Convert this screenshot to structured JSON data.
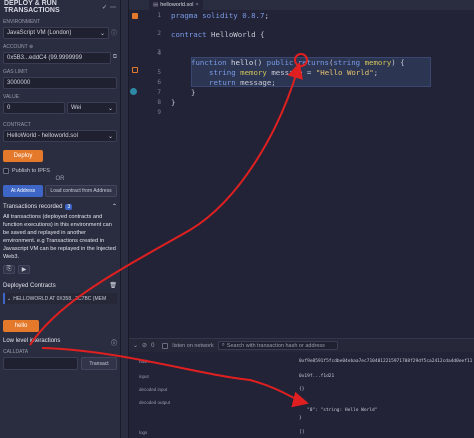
{
  "left_panel": {
    "title": "DEPLOY & RUN TRANSACTIONS",
    "environment": {
      "label": "ENVIRONMENT",
      "value": "JavaScript VM (London)"
    },
    "account": {
      "label": "ACCOUNT",
      "value": "0x5B3...eddC4 (99.9999999"
    },
    "gas_limit": {
      "label": "GAS LIMIT",
      "value": "3000000"
    },
    "value": {
      "label": "VALUE",
      "amount": "0",
      "unit": "Wei"
    },
    "contract": {
      "label": "CONTRACT",
      "value": "HelloWorld - helloworld.sol"
    },
    "deploy_label": "Deploy",
    "publish_label": "Publish to IPFS",
    "or_label": "OR",
    "at_address_label": "At Address",
    "load_contract_label": "Load contract from Address",
    "transactions": {
      "label": "Transactions recorded",
      "count": "3"
    },
    "info_text": "All transactions (deployed contracts and function executions) in this environment can be saved and replayed in another environment. e.g Transactions created in Javascript VM can be replayed in the Injected Web3.",
    "deployed_label": "Deployed Contracts",
    "instance_label": "HELLOWORLD AT 0X358...2C7BC (MEM",
    "hello_label": "hello",
    "low_level_label": "Low level interactions",
    "calldata_label": "CALLDATA",
    "transact_label": "Transact"
  },
  "editor": {
    "tab_label": "helloworld.sol",
    "line_numbers": [
      "1",
      "2",
      "3",
      "4",
      "5",
      "6",
      "7",
      "8",
      "9"
    ],
    "lines": {
      "l1_a": "pragma solidity ",
      "l1_b": "0.8.7",
      "l1_c": ";",
      "l3_a": "contract ",
      "l3_b": "HelloWorld {",
      "l5_a": "function ",
      "l5_b": "hello() ",
      "l5_c": "public ",
      "l5_d": "returns",
      "l5_e": "(",
      "l5_f": "string ",
      "l5_g": "memory",
      "l5_h": ") {",
      "l6_a": "string ",
      "l6_b": "memory ",
      "l6_c": "message = ",
      "l6_d": "\"Hello World\"",
      "l6_e": ";",
      "l7_a": "return ",
      "l7_b": "message;",
      "l8": "}",
      "l9": "}"
    }
  },
  "terminal": {
    "listen_label": "listen on network",
    "search_placeholder": "Search with transaction hash or address",
    "rows": [
      {
        "key": "hash",
        "value": "0xf9e8591f5fcdbe04ebaa7ec7104012215971708f29df5ca2412cda4d0eef11"
      },
      {
        "key": "input",
        "value": "0x19f...f1d21"
      },
      {
        "key": "decoded input",
        "value": "{}"
      },
      {
        "key": "decoded output",
        "value": "{"
      },
      {
        "key": "",
        "value": "\"0\": \"string: Hello World\""
      },
      {
        "key": "",
        "value": "}"
      },
      {
        "key": "logs",
        "value": "[]"
      }
    ]
  },
  "colors": {
    "accent_orange": "#e5792b",
    "accent_blue": "#3e66c6",
    "annotation_red": "#e02020"
  }
}
